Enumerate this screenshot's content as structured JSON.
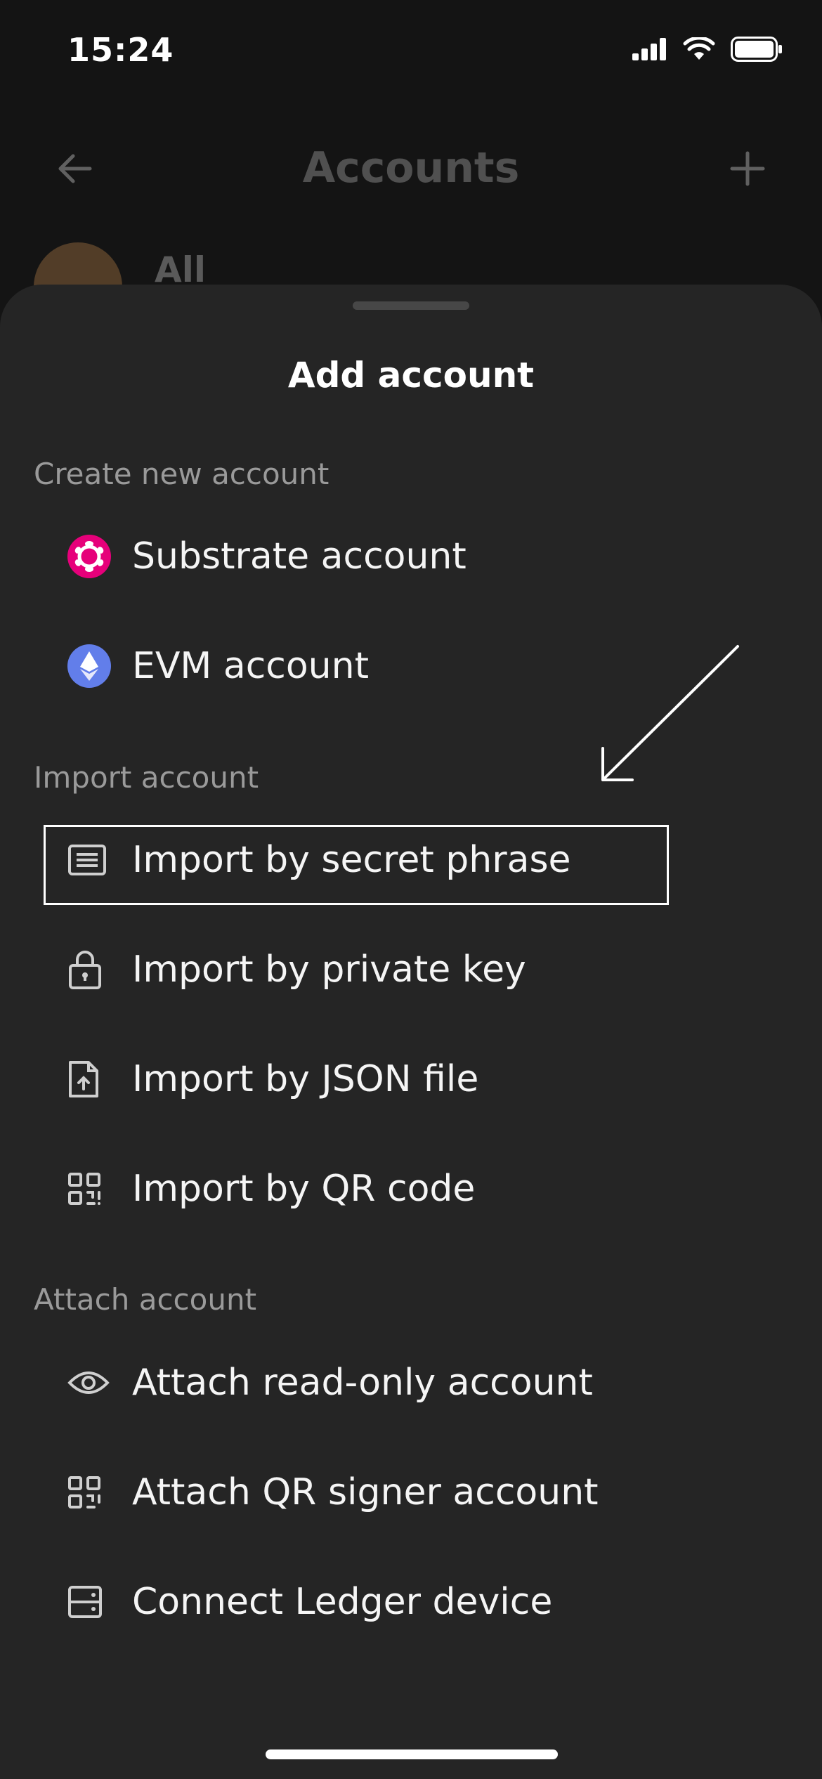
{
  "status_bar": {
    "time": "15:24"
  },
  "background": {
    "title": "Accounts",
    "all_label": "All"
  },
  "sheet": {
    "title": "Add account",
    "sections": [
      {
        "label": "Create new account",
        "items": [
          {
            "label": "Substrate account",
            "icon": "polkadot-icon"
          },
          {
            "label": "EVM account",
            "icon": "ethereum-icon"
          }
        ]
      },
      {
        "label": "Import account",
        "items": [
          {
            "label": "Import by secret phrase",
            "icon": "document-lines-icon"
          },
          {
            "label": "Import by private key",
            "icon": "lock-icon"
          },
          {
            "label": "Import by JSON file",
            "icon": "file-upload-icon"
          },
          {
            "label": "Import by QR code",
            "icon": "qr-code-icon"
          }
        ]
      },
      {
        "label": "Attach account",
        "items": [
          {
            "label": "Attach read-only account",
            "icon": "eye-icon"
          },
          {
            "label": "Attach QR signer account",
            "icon": "qr-code-icon"
          },
          {
            "label": "Connect Ledger device",
            "icon": "server-icon"
          }
        ]
      }
    ]
  },
  "colors": {
    "sheet_bg": "#252525",
    "polkadot": "#E6007A",
    "ethereum": "#627EEA",
    "section_label": "#9a9a9a"
  }
}
